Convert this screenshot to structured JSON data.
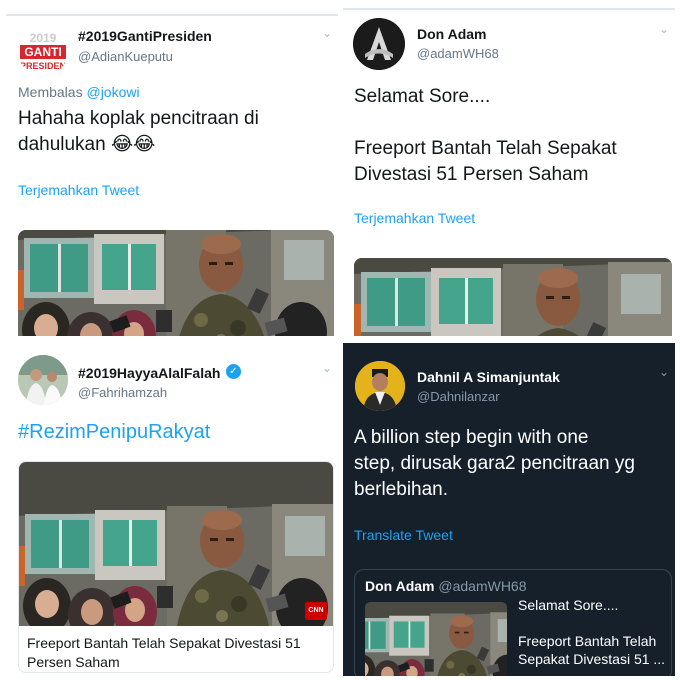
{
  "tweet1": {
    "display_name": "#2019GantiPresiden",
    "handle": "@AdianKueputu",
    "reply_prefix": "Membalas",
    "reply_to": "@jokowi",
    "text_line1": "Hahaha koplak pencitraan di",
    "text_line2": "dahulukan 😂😂",
    "translate": "Terjemahkan Tweet",
    "avatar_logo_line1": "2019",
    "avatar_logo_line2": "GANTI",
    "avatar_logo_line3": "PRESIDEN"
  },
  "tweet2": {
    "display_name": "Don Adam",
    "handle": "@adamWH68",
    "text_line1": "Selamat Sore....",
    "text_line2": "Freeport Bantah Telah Sepakat",
    "text_line3": "Divestasi 51 Persen Saham",
    "translate": "Terjemahkan Tweet"
  },
  "tweet3": {
    "display_name": "#2019HayyaAlalFalah",
    "handle": "@Fahrihamzah",
    "hashtag": "#RezimPenipuRakyat",
    "card_title_line1": "Freeport Bantah Telah Sepakat Divestasi 51",
    "card_title_line2": "Persen Saham",
    "badge": "CNN"
  },
  "tweet4": {
    "display_name": "Dahnil A Simanjuntak",
    "handle": "@Dahnilanzar",
    "text_line1": "A billion step begin with one",
    "text_line2": "step, dirusak gara2 pencitraan yg",
    "text_line3": "berlebihan.",
    "translate": "Translate Tweet",
    "quote_name": "Don Adam",
    "quote_handle": "@adamWH68",
    "quote_line1": "Selamat Sore....",
    "quote_line2": "Freeport Bantah Telah",
    "quote_line3": "Sepakat Divestasi 51 ..."
  },
  "colors": {
    "link": "#1da1f2",
    "verified": "#1da1f2",
    "dark_bg": "#15202b"
  },
  "icons": [
    "chevron-down-icon",
    "verified-badge-icon"
  ]
}
